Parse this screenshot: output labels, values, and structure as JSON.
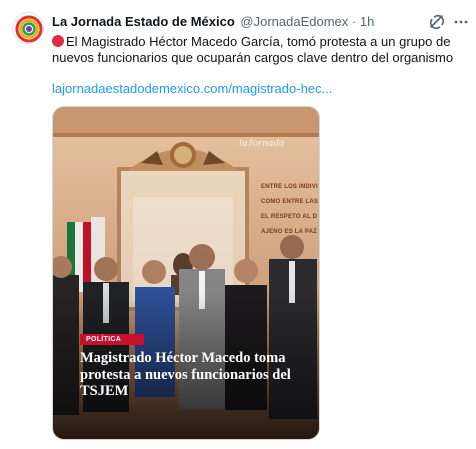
{
  "account": {
    "name": "La Jornada Estado de México",
    "handle": "@JornadaEdomex",
    "separator": "·",
    "time": "1h"
  },
  "tweet": {
    "text": "El Magistrado Héctor Macedo García, tomó protesta a un grupo de nuevos funcionarios que ocuparán cargos clave dentro del organismo",
    "link": "lajornadaestadodemexico.com/magistrado-hec..."
  },
  "media": {
    "watermark": "laJornada",
    "badge": "POLÍTICA",
    "headline": "Magistrado Héctor Macedo toma protesta a nuevos funcionarios del TSJEM",
    "wall_lines": [
      "ENTRE LOS INDIVI",
      "COMO ENTRE LAS N",
      "EL RESPETO AL D",
      "AJENO ES LA PAZ"
    ]
  },
  "icons": {
    "grok": "grok-icon",
    "more": "more-options-icon",
    "emoji": "red-circle-icon"
  },
  "colors": {
    "accent": "#1d9bf0",
    "badge": "#c8102e",
    "muted": "#536471"
  }
}
